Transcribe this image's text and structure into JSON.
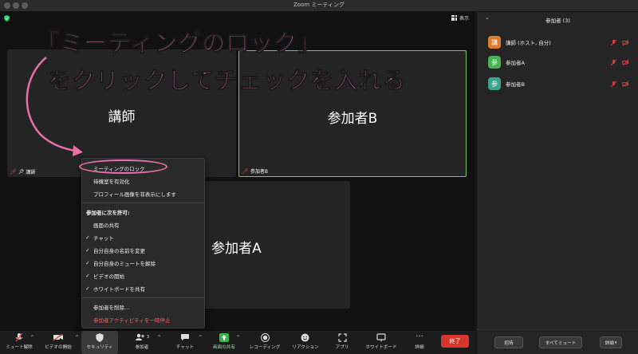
{
  "window": {
    "title": "Zoom ミーティング"
  },
  "top": {
    "view_label": "表示"
  },
  "videos": [
    {
      "name": "講師",
      "tag": "講師"
    },
    {
      "name": "参加者B",
      "tag": "参加者B"
    },
    {
      "name": "参加者A"
    }
  ],
  "annotation": {
    "line1": "「ミーティングのロック」",
    "line2": "をクリックしてチェックを入れる",
    "color": "#e96fa8"
  },
  "security_menu": {
    "items_top": [
      "ミーティングのロック",
      "待機室を有効化",
      "プロフィール画像を非表示にします"
    ],
    "allow_heading": "参加者に次を許可:",
    "allow_items": [
      {
        "label": "画面の共有",
        "checked": false
      },
      {
        "label": "チャット",
        "checked": true
      },
      {
        "label": "自分自身の名前を変更",
        "checked": true
      },
      {
        "label": "自分自身のミュートを解除",
        "checked": true
      },
      {
        "label": "ビデオの開始",
        "checked": true
      },
      {
        "label": "ホワイトボードを共有",
        "checked": true
      }
    ],
    "remove": "参加者を削除...",
    "suspend": "参加者アクティビティを一時停止"
  },
  "toolbar": {
    "unmute": "ミュート解除",
    "start_video": "ビデオの開始",
    "security": "セキュリティ",
    "participants": "参加者",
    "participant_count": "3",
    "chat": "チャット",
    "share": "画面の共有",
    "record": "レコーディング",
    "reactions": "リアクション",
    "apps": "アプリ",
    "whiteboard": "ホワイトボード",
    "more": "詳細",
    "end": "終了"
  },
  "panel": {
    "title": "参加者 (3)",
    "participants": [
      {
        "avatar": "講",
        "name": "講師 (ホスト, 自分)",
        "color": "#e07b2a"
      },
      {
        "avatar": "参",
        "name": "参加者A",
        "color": "#4caf50"
      },
      {
        "avatar": "参",
        "name": "参加者B",
        "color": "#3aa58f"
      }
    ],
    "invite": "招待",
    "mute_all": "すべてミュート",
    "more": "詳細"
  },
  "colors": {
    "end_button": "#d9342b",
    "highlight_border": "#7fbf6a",
    "share_green": "#3cb34a"
  }
}
